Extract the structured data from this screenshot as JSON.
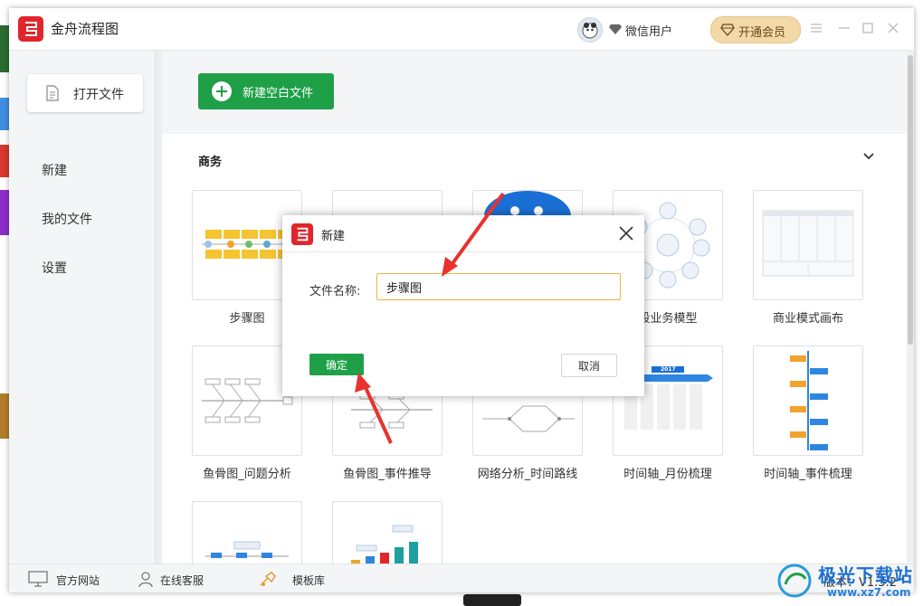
{
  "app": {
    "title": "金舟流程图"
  },
  "user": {
    "name": "微信用户",
    "vip_label": "开通会员"
  },
  "sidebar": {
    "open_file": "打开文件",
    "items": [
      {
        "label": "新建"
      },
      {
        "label": "我的文件"
      },
      {
        "label": "设置"
      }
    ]
  },
  "main": {
    "new_blank": "新建空白文件",
    "section": "商务",
    "templates": [
      {
        "label": "步骤图"
      },
      {
        "label": ""
      },
      {
        "label": ""
      },
      {
        "label": "段业务模型"
      },
      {
        "label": "商业模式画布"
      },
      {
        "label": "鱼骨图_问题分析"
      },
      {
        "label": "鱼骨图_事件推导"
      },
      {
        "label": "网络分析_时间路线"
      },
      {
        "label": "时间轴_月份梳理"
      },
      {
        "label": "时间轴_事件梳理"
      },
      {
        "label": ""
      },
      {
        "label": ""
      }
    ],
    "timeline_year": "2017"
  },
  "bottom": {
    "website": "官方网站",
    "service": "在线客服",
    "templates": "模板库",
    "version": "版本：V1.3.2"
  },
  "dialog": {
    "title": "新建",
    "field_label": "文件名称:",
    "file_name": "步骤图",
    "ok": "确定",
    "cancel": "取消"
  },
  "watermark": {
    "name": "极光下载站",
    "url": "www.xz7.com"
  },
  "colors": {
    "accent_green": "#1fa048",
    "brand_red": "#e0262a",
    "vip_gold": "#f3d9a8",
    "arrow_red": "#e8322d",
    "input_border": "#f0b440"
  }
}
